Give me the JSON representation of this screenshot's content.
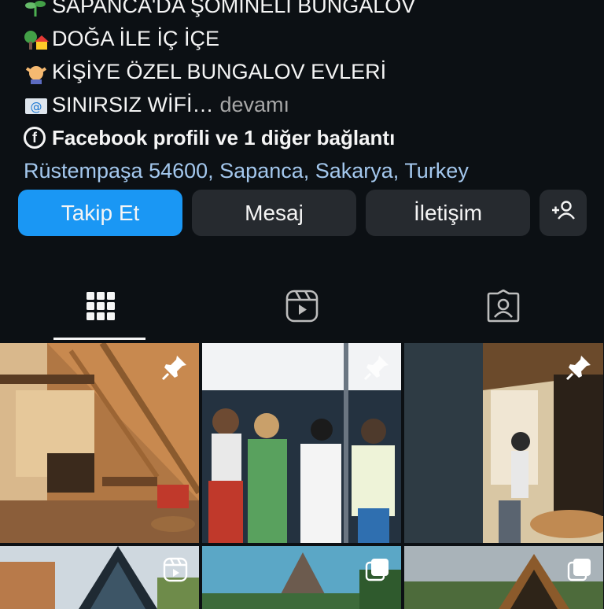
{
  "bio": {
    "line0": "SAPANCA'DA ŞÖMİNELİ BUNGALOV",
    "line1": "DOĞA İLE İÇ İÇE",
    "line2": "KİŞİYE ÖZEL BUNGALOV EVLERİ",
    "line3": "SINIRSIZ WİFİ…",
    "more": "devamı",
    "links": "Facebook profili ve 1 diğer bağlantı",
    "location": "Rüstempaşa 54600, Sapanca, Sakarya, Turkey"
  },
  "actions": {
    "follow": "Takip Et",
    "message": "Mesaj",
    "contact": "İletişim"
  },
  "tabs": [
    "grid",
    "reels",
    "tagged"
  ],
  "grid": {
    "posts": [
      {
        "type": "pinned"
      },
      {
        "type": "pinned"
      },
      {
        "type": "pinned"
      },
      {
        "type": "reel"
      },
      {
        "type": "carousel"
      },
      {
        "type": "carousel"
      }
    ]
  },
  "colors": {
    "background": "#0c1014",
    "primary_button": "#1a97f4",
    "secondary_button": "#262a2f",
    "link": "#a4c8ee"
  }
}
